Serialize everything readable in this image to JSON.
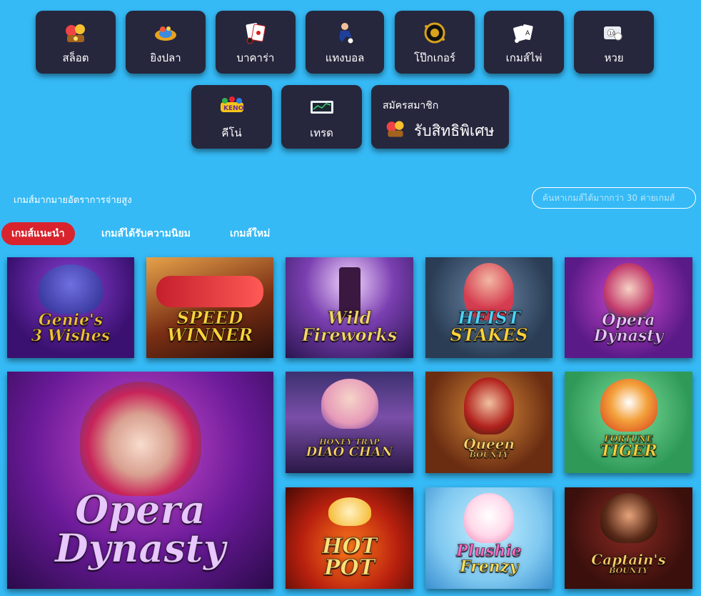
{
  "categories": [
    {
      "label": "สล็อต",
      "icon": "slot-icon"
    },
    {
      "label": "ยิงปลา",
      "icon": "fish-icon"
    },
    {
      "label": "บาคาร่า",
      "icon": "baccarat-icon"
    },
    {
      "label": "แทงบอล",
      "icon": "football-icon"
    },
    {
      "label": "โป๊กเกอร์",
      "icon": "poker-icon"
    },
    {
      "label": "เกมส์ไพ่",
      "icon": "cards-icon"
    },
    {
      "label": "หวย",
      "icon": "lottery-icon"
    },
    {
      "label": "คีโน่",
      "icon": "keno-icon"
    },
    {
      "label": "เทรด",
      "icon": "trade-icon"
    }
  ],
  "promo": {
    "line1": "สมัครสมาชิก",
    "line2": "รับสิทธิพิเศษ"
  },
  "section": {
    "subtitle": "เกมส์มากมายอัตราการจ่ายสูง",
    "search_placeholder": "ค้นหาเกมส์ได้มากกว่า 30 ค่ายเกมส์"
  },
  "tabs": [
    "เกมส์แนะนำ",
    "เกมส์ได้รับความนิยม",
    "เกมส์ใหม่"
  ],
  "colors": {
    "background": "#35baf6",
    "card": "#26273d",
    "active_tab": "#d9232d"
  },
  "games": [
    {
      "title": "Genie's 3 Wishes",
      "logo_lines": [
        "Genie's",
        "3 Wishes"
      ]
    },
    {
      "title": "Speed Winner",
      "logo_lines": [
        "SPEED",
        "WINNER"
      ]
    },
    {
      "title": "Wild Fireworks",
      "logo_lines": [
        "Wild",
        "Fireworks"
      ]
    },
    {
      "title": "Heist Stakes",
      "logo_lines": [
        "HEIST",
        "STAKES"
      ]
    },
    {
      "title": "Opera Dynasty",
      "logo_lines": [
        "Opera",
        "Dynasty"
      ]
    },
    {
      "title": "Opera Dynasty",
      "logo_lines": [
        "Opera",
        "Dynasty"
      ]
    },
    {
      "title": "Honey Trap of Diao Chan",
      "logo_lines": [
        "HONEY TRAP",
        "DIAO CHAN"
      ]
    },
    {
      "title": "Queen of Bounty",
      "logo_lines": [
        "Queen",
        "BOUNTY"
      ]
    },
    {
      "title": "Fortune Tiger",
      "logo_lines": [
        "FORTUNE",
        "TIGER"
      ]
    },
    {
      "title": "Hot Pot",
      "logo_lines": [
        "HOT",
        "POT"
      ]
    },
    {
      "title": "Plushie Frenzy",
      "logo_lines": [
        "Plushie",
        "Frenzy"
      ]
    },
    {
      "title": "Captain's Bounty",
      "logo_lines": [
        "Captain's",
        "BOUNTY"
      ]
    }
  ]
}
